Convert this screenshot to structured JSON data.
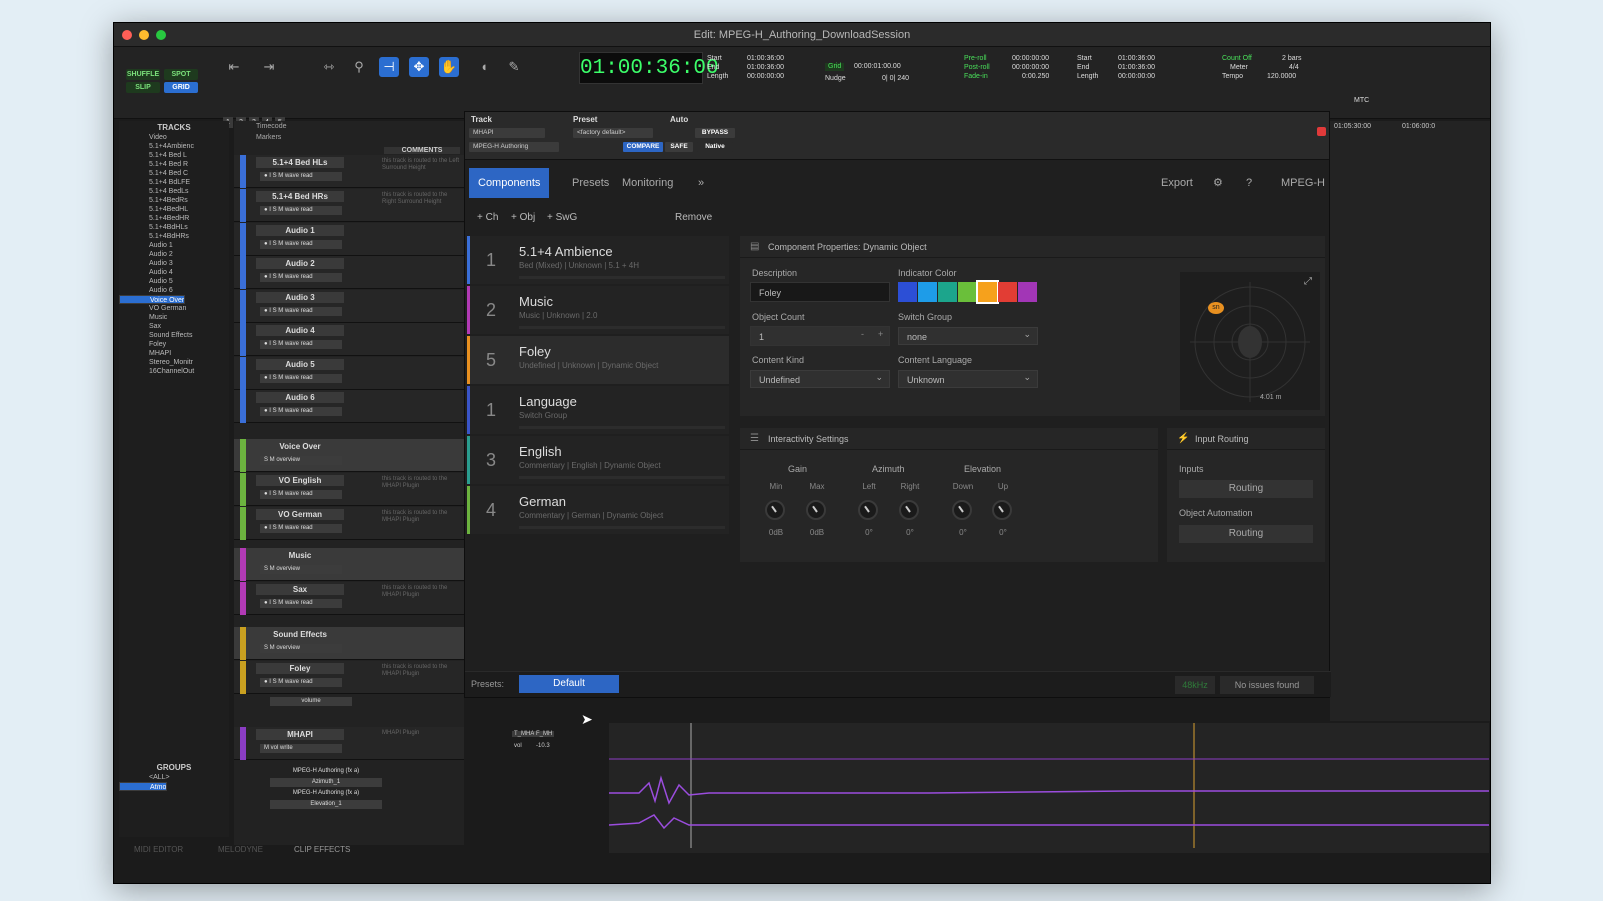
{
  "window": {
    "title": "Edit: MPEG-H_Authoring_DownloadSession"
  },
  "toolbar": {
    "modes": [
      "SHUFFLE",
      "SPOT",
      "SLIP",
      "GRID"
    ],
    "counter": "01:00:36:00",
    "sel": {
      "start_l": "Start",
      "end_l": "End",
      "len_l": "Length",
      "start": "01:00:36:00",
      "end": "01:00:36:00",
      "len": "00:00:00:00"
    },
    "grid": {
      "label": "Grid",
      "value": "00:00:01:00.00",
      "nudge_l": "Nudge",
      "nudge": "0| 0| 240"
    },
    "pre": {
      "preroll": "Pre-roll",
      "postroll": "Post-roll",
      "fadein": "Fade-in",
      "v1": "00:00:00:00",
      "v2": "00:00:00:00",
      "v3": "0:00.250"
    },
    "sel2": {
      "start": "01:00:36:00",
      "end": "01:00:36:00",
      "len": "00:00:00:00"
    },
    "count": {
      "countoff": "Count Off",
      "meter": "Meter",
      "tempo": "Tempo",
      "bars": "2 bars",
      "sig": "4/4",
      "bpm": "120.0000"
    },
    "nums": [
      "1",
      "2",
      "3",
      "4",
      "5"
    ],
    "mtc": "MTC"
  },
  "tracks_panel": {
    "header": "TRACKS",
    "items": [
      "Video",
      "5.1+4Ambienc",
      "5.1+4 Bed L",
      "5.1+4 Bed R",
      "5.1+4 Bed C",
      "5.1+4 BdLFE",
      "5.1+4 BedLs",
      "5.1+4BedRs",
      "5.1+4BedHL",
      "5.1+4BedHR",
      "5.1+4BdHLs",
      "5.1+4BdHRs",
      "Audio 1",
      "Audio 2",
      "Audio 3",
      "Audio 4",
      "Audio 5",
      "Audio 6",
      "Voice Over",
      "VO English",
      "VO German",
      "Music",
      "Sax",
      "Sound Effects",
      "Foley",
      "MHAPI",
      "Stereo_Monitr",
      "16ChannelOut"
    ]
  },
  "groups_panel": {
    "header": "GROUPS",
    "items": [
      "<ALL>",
      "Atmo"
    ]
  },
  "rulers": {
    "timecode": "Timecode",
    "markers": "Markers",
    "comments": "COMMENTS"
  },
  "edit_tracks": [
    {
      "name": "5.1+4 Bed HLs",
      "btns": "● I S M  wave  read",
      "cmt": "this track is routed to the Left Surround Height"
    },
    {
      "name": "5.1+4 Bed HRs",
      "btns": "● I S M  wave  read",
      "cmt": "this track is routed to the Right Surround Height"
    },
    {
      "name": "Audio 1",
      "btns": "● I S M  wave  read",
      "cmt": ""
    },
    {
      "name": "Audio 2",
      "btns": "● I S M  wave  read",
      "cmt": ""
    },
    {
      "name": "Audio 3",
      "btns": "● I S M  wave  read",
      "cmt": ""
    },
    {
      "name": "Audio 4",
      "btns": "● I S M  wave  read",
      "cmt": ""
    },
    {
      "name": "Audio 5",
      "btns": "● I S M  wave  read",
      "cmt": ""
    },
    {
      "name": "Audio 6",
      "btns": "● I S M  wave  read",
      "cmt": ""
    },
    {
      "name": "Voice Over",
      "btns": "S M  overview",
      "cmt": ""
    },
    {
      "name": "VO English",
      "btns": "● I S M  wave  read",
      "cmt": "this track is routed to the MHAPI Plugin"
    },
    {
      "name": "VO German",
      "btns": "● I S M  wave  read",
      "cmt": "this track is routed to the MHAPI Plugin"
    },
    {
      "name": "Music",
      "btns": "S M  overview",
      "cmt": ""
    },
    {
      "name": "Sax",
      "btns": "● I S M  wave  read",
      "cmt": "this track is routed to the MHAPI Plugin"
    },
    {
      "name": "Sound Effects",
      "btns": "S M  overview",
      "cmt": ""
    },
    {
      "name": "Foley",
      "btns": "● I S M  wave  read",
      "cmt": "this track is routed to the MHAPI Plugin"
    },
    {
      "name": "MHAPI",
      "btns": "M  vol  write",
      "cmt": "MHAPI Plugin"
    }
  ],
  "foley_sub": "volume",
  "mhapi_lanes": [
    "MPEG-H Authoring (fx a)",
    "Azimuth_1",
    "MPEG-H Authoring (fx a)",
    "Elevation_1"
  ],
  "mhapi_io": {
    "a": "T_MHA",
    "b": "F_MH",
    "vol": "vol",
    "db": "-10.3"
  },
  "plugin": {
    "track_l": "Track",
    "preset_l": "Preset",
    "auto_l": "Auto",
    "track": "MHAPI",
    "insert": "MPEG-H Authoring",
    "preset": "<factory default>",
    "bypass": "BYPASS",
    "compare": "COMPARE",
    "safe": "SAFE",
    "native": "Native",
    "tabs": [
      "Components",
      "Presets",
      "Monitoring"
    ],
    "more": "»",
    "export": "Export",
    "brand": "MPEG-H",
    "add": [
      "+ Ch",
      "+ Obj",
      "+ SwG"
    ],
    "remove": "Remove",
    "components": [
      {
        "num": "1",
        "name": "5.1+4 Ambience",
        "sub": "Bed (Mixed) | Unknown | 5.1 + 4H",
        "color": "#3a6fd8"
      },
      {
        "num": "2",
        "name": "Music",
        "sub": "Music | Unknown | 2.0",
        "color": "#b23ab5"
      },
      {
        "num": "5",
        "name": "Foley",
        "sub": "Undefined | Unknown | Dynamic Object",
        "color": "#e89020"
      },
      {
        "num": "1",
        "name": "Language",
        "sub": "Switch Group",
        "color": "#3a55c8"
      },
      {
        "num": "3",
        "name": "English",
        "sub": "Commentary | English | Dynamic Object",
        "color": "#2a9d8f"
      },
      {
        "num": "4",
        "name": "German",
        "sub": "Commentary | German | Dynamic Object",
        "color": "#6cb33f"
      }
    ],
    "props": {
      "title": "Component Properties: Dynamic Object",
      "desc_l": "Description",
      "desc": "Foley",
      "ind_l": "Indicator Color",
      "count_l": "Object Count",
      "count": "1",
      "switch_l": "Switch Group",
      "switch": "none",
      "kind_l": "Content Kind",
      "kind": "Undefined",
      "lang_l": "Content Language",
      "lang": "Unknown",
      "colors": [
        "#2c4fd6",
        "#1e9ce8",
        "#1ca58c",
        "#6abf3a",
        "#f6a11c",
        "#e23d34",
        "#a236b6"
      ],
      "scope_tag": "sn",
      "scope_dist": "4.01 m"
    },
    "inter": {
      "title": "Interactivity Settings",
      "gain": "Gain",
      "azimuth": "Azimuth",
      "elevation": "Elevation",
      "sub": [
        "Min",
        "Max",
        "Left",
        "Right",
        "Down",
        "Up"
      ],
      "vals": [
        "0dB",
        "0dB",
        "0°",
        "0°",
        "0°",
        "0°"
      ]
    },
    "routing": {
      "title": "Input Routing",
      "inputs": "Inputs",
      "obj": "Object Automation",
      "btn": "Routing"
    },
    "footer": {
      "presets_l": "Presets:",
      "preset": "Default",
      "rate": "48kHz",
      "status": "No issues found"
    }
  },
  "timeline": {
    "t1": "01:05:30:00",
    "t2": "01:06:00:0"
  },
  "bottom": {
    "mix": "MIDI EDITOR",
    "mel": "MELODYNE",
    "clip": "CLIP EFFECTS"
  }
}
